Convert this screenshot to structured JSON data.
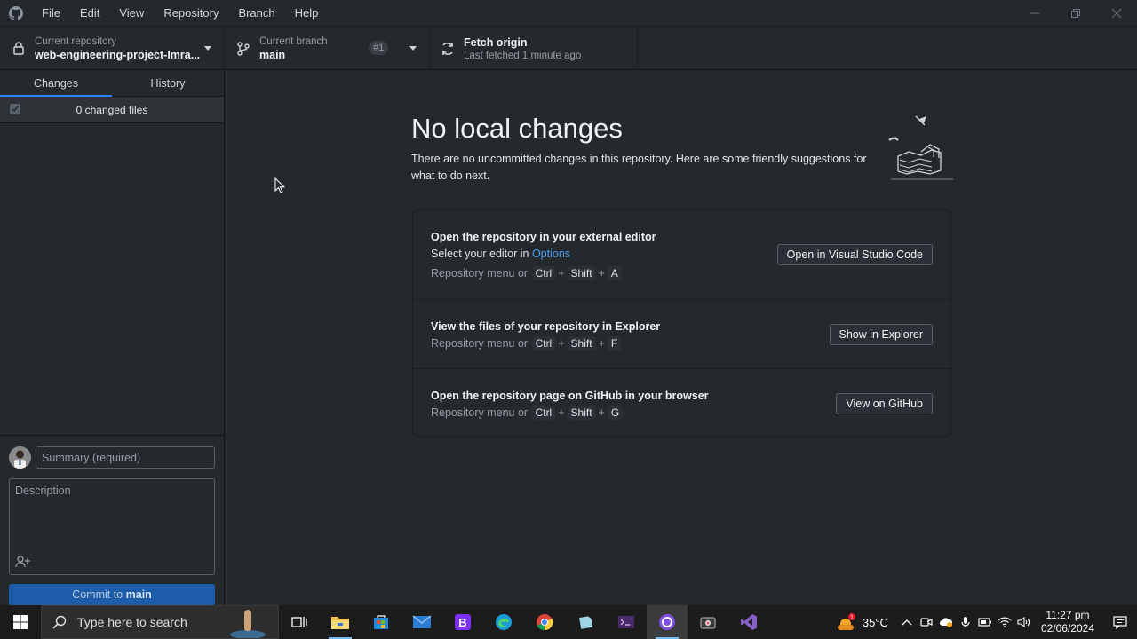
{
  "menu": [
    "File",
    "Edit",
    "View",
    "Repository",
    "Branch",
    "Help"
  ],
  "toolbar": {
    "repo_label": "Current repository",
    "repo_value": "web-engineering-project-Imra...",
    "branch_label": "Current branch",
    "branch_value": "main",
    "pr_badge": "#1",
    "fetch_label": "Fetch origin",
    "fetch_sub": "Last fetched 1 minute ago"
  },
  "sidebar": {
    "tab_changes": "Changes",
    "tab_history": "History",
    "changed_files": "0 changed files",
    "summary_placeholder": "Summary (required)",
    "description_placeholder": "Description",
    "commit_prefix": "Commit to ",
    "commit_branch": "main"
  },
  "main": {
    "heading": "No local changes",
    "subtext": "There are no uncommitted changes in this repository. Here are some friendly suggestions for what to do next.",
    "suggestions": [
      {
        "title": "Open the repository in your external editor",
        "desc_prefix": "Select your editor in ",
        "desc_link": "Options",
        "shortcut_prefix": "Repository menu or",
        "keys": [
          "Ctrl",
          "Shift",
          "A"
        ],
        "button": "Open in Visual Studio Code"
      },
      {
        "title": "View the files of your repository in Explorer",
        "shortcut_prefix": "Repository menu or",
        "keys": [
          "Ctrl",
          "Shift",
          "F"
        ],
        "button": "Show in Explorer"
      },
      {
        "title": "Open the repository page on GitHub in your browser",
        "shortcut_prefix": "Repository menu or",
        "keys": [
          "Ctrl",
          "Shift",
          "G"
        ],
        "button": "View on GitHub"
      }
    ]
  },
  "taskbar": {
    "search_placeholder": "Type here to search",
    "temperature": "35°C",
    "time": "11:27 pm",
    "date": "02/06/2024",
    "weather_badge": "1"
  },
  "colors": {
    "accent": "#2f81f7",
    "link": "#4a9eed",
    "commit_button": "#1d5ca8",
    "background": "#24292e"
  }
}
